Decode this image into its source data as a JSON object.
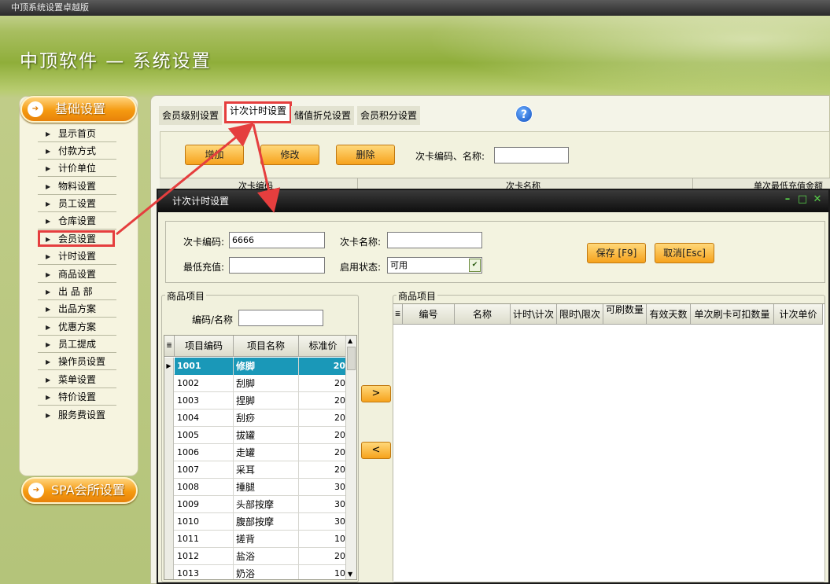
{
  "window_title": "中顶系统设置卓越版",
  "app_title": "中顶软件 — 系统设置",
  "sidebar": {
    "section_basic": "基础设置",
    "section_spa": "SPA会所设置",
    "items": [
      "显示首页",
      "付款方式",
      "计价单位",
      "物料设置",
      "员工设置",
      "仓库设置",
      "会员设置",
      "计时设置",
      "商品设置",
      "出 品 部",
      "出品方案",
      "优惠方案",
      "员工提成",
      "操作员设置",
      "菜单设置",
      "特价设置",
      "服务费设置"
    ],
    "highlighted_item": "会员设置"
  },
  "tabs": [
    "会员级别设置",
    "计次计时设置",
    "储值折兑设置",
    "会员积分设置"
  ],
  "active_tab": "计次计时设置",
  "toolbar": {
    "add": "增加",
    "edit": "修改",
    "delete": "删除",
    "search_label": "次卡编码、名称:",
    "search_value": ""
  },
  "background_grid_headers": [
    "次卡编码",
    "次卡名称",
    "单次最低充值金额"
  ],
  "dialog": {
    "title": "计次计时设置",
    "card_code_label": "次卡编码:",
    "card_code_value": "6666",
    "card_name_label": "次卡名称:",
    "card_name_value": "",
    "min_recharge_label": "最低充值:",
    "min_recharge_value": "",
    "status_label": "启用状态:",
    "status_value": "可用",
    "save": "保存 [F9]",
    "cancel": "取消[Esc]",
    "left_group": {
      "title": "商品项目",
      "search_label": "编码/名称",
      "search_value": "",
      "columns": [
        "项目编码",
        "项目名称",
        "标准价"
      ],
      "rows": [
        [
          "1001",
          "修脚",
          "20"
        ],
        [
          "1002",
          "刮脚",
          "20"
        ],
        [
          "1003",
          "捏脚",
          "20"
        ],
        [
          "1004",
          "刮痧",
          "20"
        ],
        [
          "1005",
          "拔罐",
          "20"
        ],
        [
          "1006",
          "走罐",
          "20"
        ],
        [
          "1007",
          "采耳",
          "20"
        ],
        [
          "1008",
          "捶腿",
          "30"
        ],
        [
          "1009",
          "头部按摩",
          "30"
        ],
        [
          "1010",
          "腹部按摩",
          "30"
        ],
        [
          "1011",
          "搓背",
          "10"
        ],
        [
          "1012",
          "盐浴",
          "20"
        ],
        [
          "1013",
          "奶浴",
          "10"
        ]
      ],
      "selected_row": "1001"
    },
    "move_right": ">",
    "move_left": "<",
    "right_group": {
      "title": "商品项目",
      "columns": [
        "编号",
        "名称",
        "计时\\计次",
        "限时\\限次",
        "可刷数量",
        "有效天数",
        "单次刷卡可扣数量",
        "计次单价"
      ]
    }
  },
  "colors": {
    "accent_orange": "#f6a21c",
    "annotation_red": "#e53e3e",
    "selection": "#1a98b8"
  }
}
